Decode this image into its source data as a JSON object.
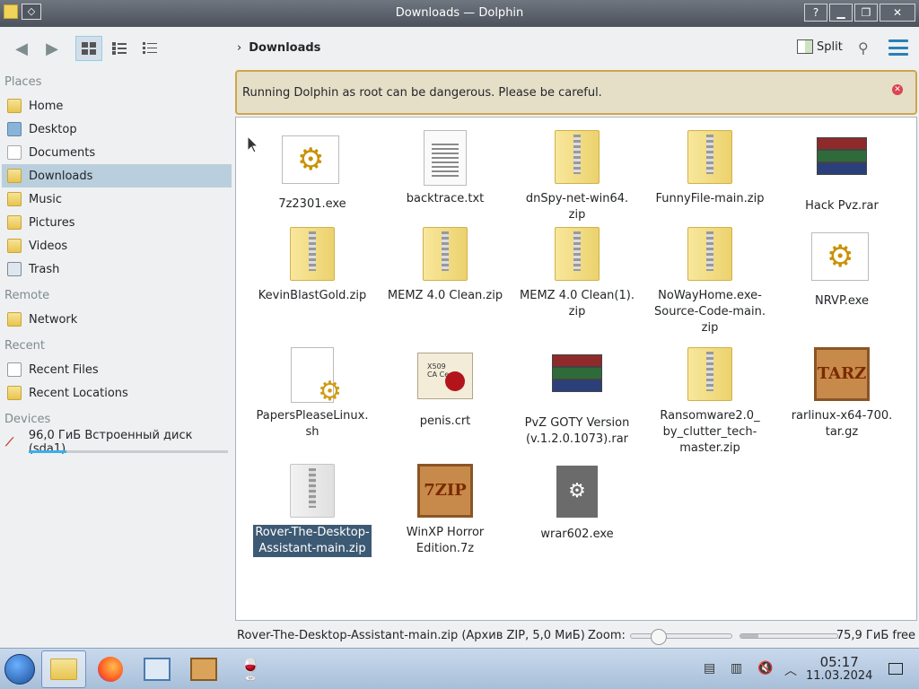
{
  "window": {
    "title": "Downloads — Dolphin",
    "buttons": {
      "help": "?",
      "minimize": "▁",
      "maximize": "❐",
      "close": "✕"
    }
  },
  "toolbar": {
    "back_icon": "arrow-left-icon",
    "forward_icon": "arrow-right-icon",
    "breadcrumb_chevron": "›",
    "breadcrumb": "Downloads",
    "split_label": "Split"
  },
  "sidebar": {
    "places_header": "Places",
    "places": [
      {
        "label": "Home",
        "icon": "home-folder-icon"
      },
      {
        "label": "Desktop",
        "icon": "desktop-icon"
      },
      {
        "label": "Documents",
        "icon": "documents-icon"
      },
      {
        "label": "Downloads",
        "icon": "downloads-folder-icon",
        "selected": true
      },
      {
        "label": "Music",
        "icon": "music-folder-icon"
      },
      {
        "label": "Pictures",
        "icon": "pictures-folder-icon"
      },
      {
        "label": "Videos",
        "icon": "videos-folder-icon"
      },
      {
        "label": "Trash",
        "icon": "trash-icon"
      }
    ],
    "remote_header": "Remote",
    "remote": [
      {
        "label": "Network",
        "icon": "network-icon"
      }
    ],
    "recent_header": "Recent",
    "recent": [
      {
        "label": "Recent Files",
        "icon": "recent-files-icon"
      },
      {
        "label": "Recent Locations",
        "icon": "recent-locations-icon"
      }
    ],
    "devices_header": "Devices",
    "device": {
      "label": "96,0 ГиБ Встроенный диск (sda1)",
      "used_fraction": 0.19
    }
  },
  "warning": {
    "message": "Running Dolphin as root can be dangerous. Please be careful.",
    "close_icon": "close-icon"
  },
  "files": [
    {
      "name": "7z2301.exe",
      "type": "exe"
    },
    {
      "name": "backtrace.txt",
      "type": "txt"
    },
    {
      "name": "dnSpy-net-win64.\nzip",
      "type": "zip"
    },
    {
      "name": "FunnyFile-main.zip",
      "type": "zip"
    },
    {
      "name": "Hack Pvz.rar",
      "type": "rar"
    },
    {
      "name": "KevinBlastGold.zip",
      "type": "zip"
    },
    {
      "name": "MEMZ 4.0 Clean.zip",
      "type": "zip"
    },
    {
      "name": "MEMZ 4.0 Clean(1).\nzip",
      "type": "zip"
    },
    {
      "name": "NoWayHome.exe-\nSource-Code-main.\nzip",
      "type": "zip"
    },
    {
      "name": "NRVP.exe",
      "type": "exe"
    },
    {
      "name": "PapersPleaseLinux.\nsh",
      "type": "sh"
    },
    {
      "name": "penis.crt",
      "type": "crt"
    },
    {
      "name": "PvZ GOTY Version\n(v.1.2.0.1073).rar",
      "type": "rar"
    },
    {
      "name": "Ransomware2.0_\nby_clutter_tech-\nmaster.zip",
      "type": "zip"
    },
    {
      "name": "rarlinux-x64-700.\ntar.gz",
      "type": "targz"
    },
    {
      "name": "Rover-The-Desktop-\nAssistant-main.zip",
      "type": "zip-pale",
      "selected": true
    },
    {
      "name": "WinXP Horror\nEdition.7z",
      "type": "7z"
    },
    {
      "name": "wrar602.exe",
      "type": "wrar"
    }
  ],
  "icon_text": {
    "targz": "TARZ",
    "7z": "7ZIP",
    "crt": "X509\nCA Cert"
  },
  "statusbar": {
    "info": "Rover-The-Desktop-Assistant-main.zip (Архив ZIP, 5,0 МиБ)",
    "zoom_label": "Zoom:",
    "free_space": "75,9 ГиБ free"
  },
  "taskbar": {
    "apps": [
      "file-manager-icon",
      "firefox-icon",
      "system-monitor-icon",
      "package-icon",
      "wine-icon"
    ],
    "time": "05:17",
    "date": "11.03.2024"
  }
}
